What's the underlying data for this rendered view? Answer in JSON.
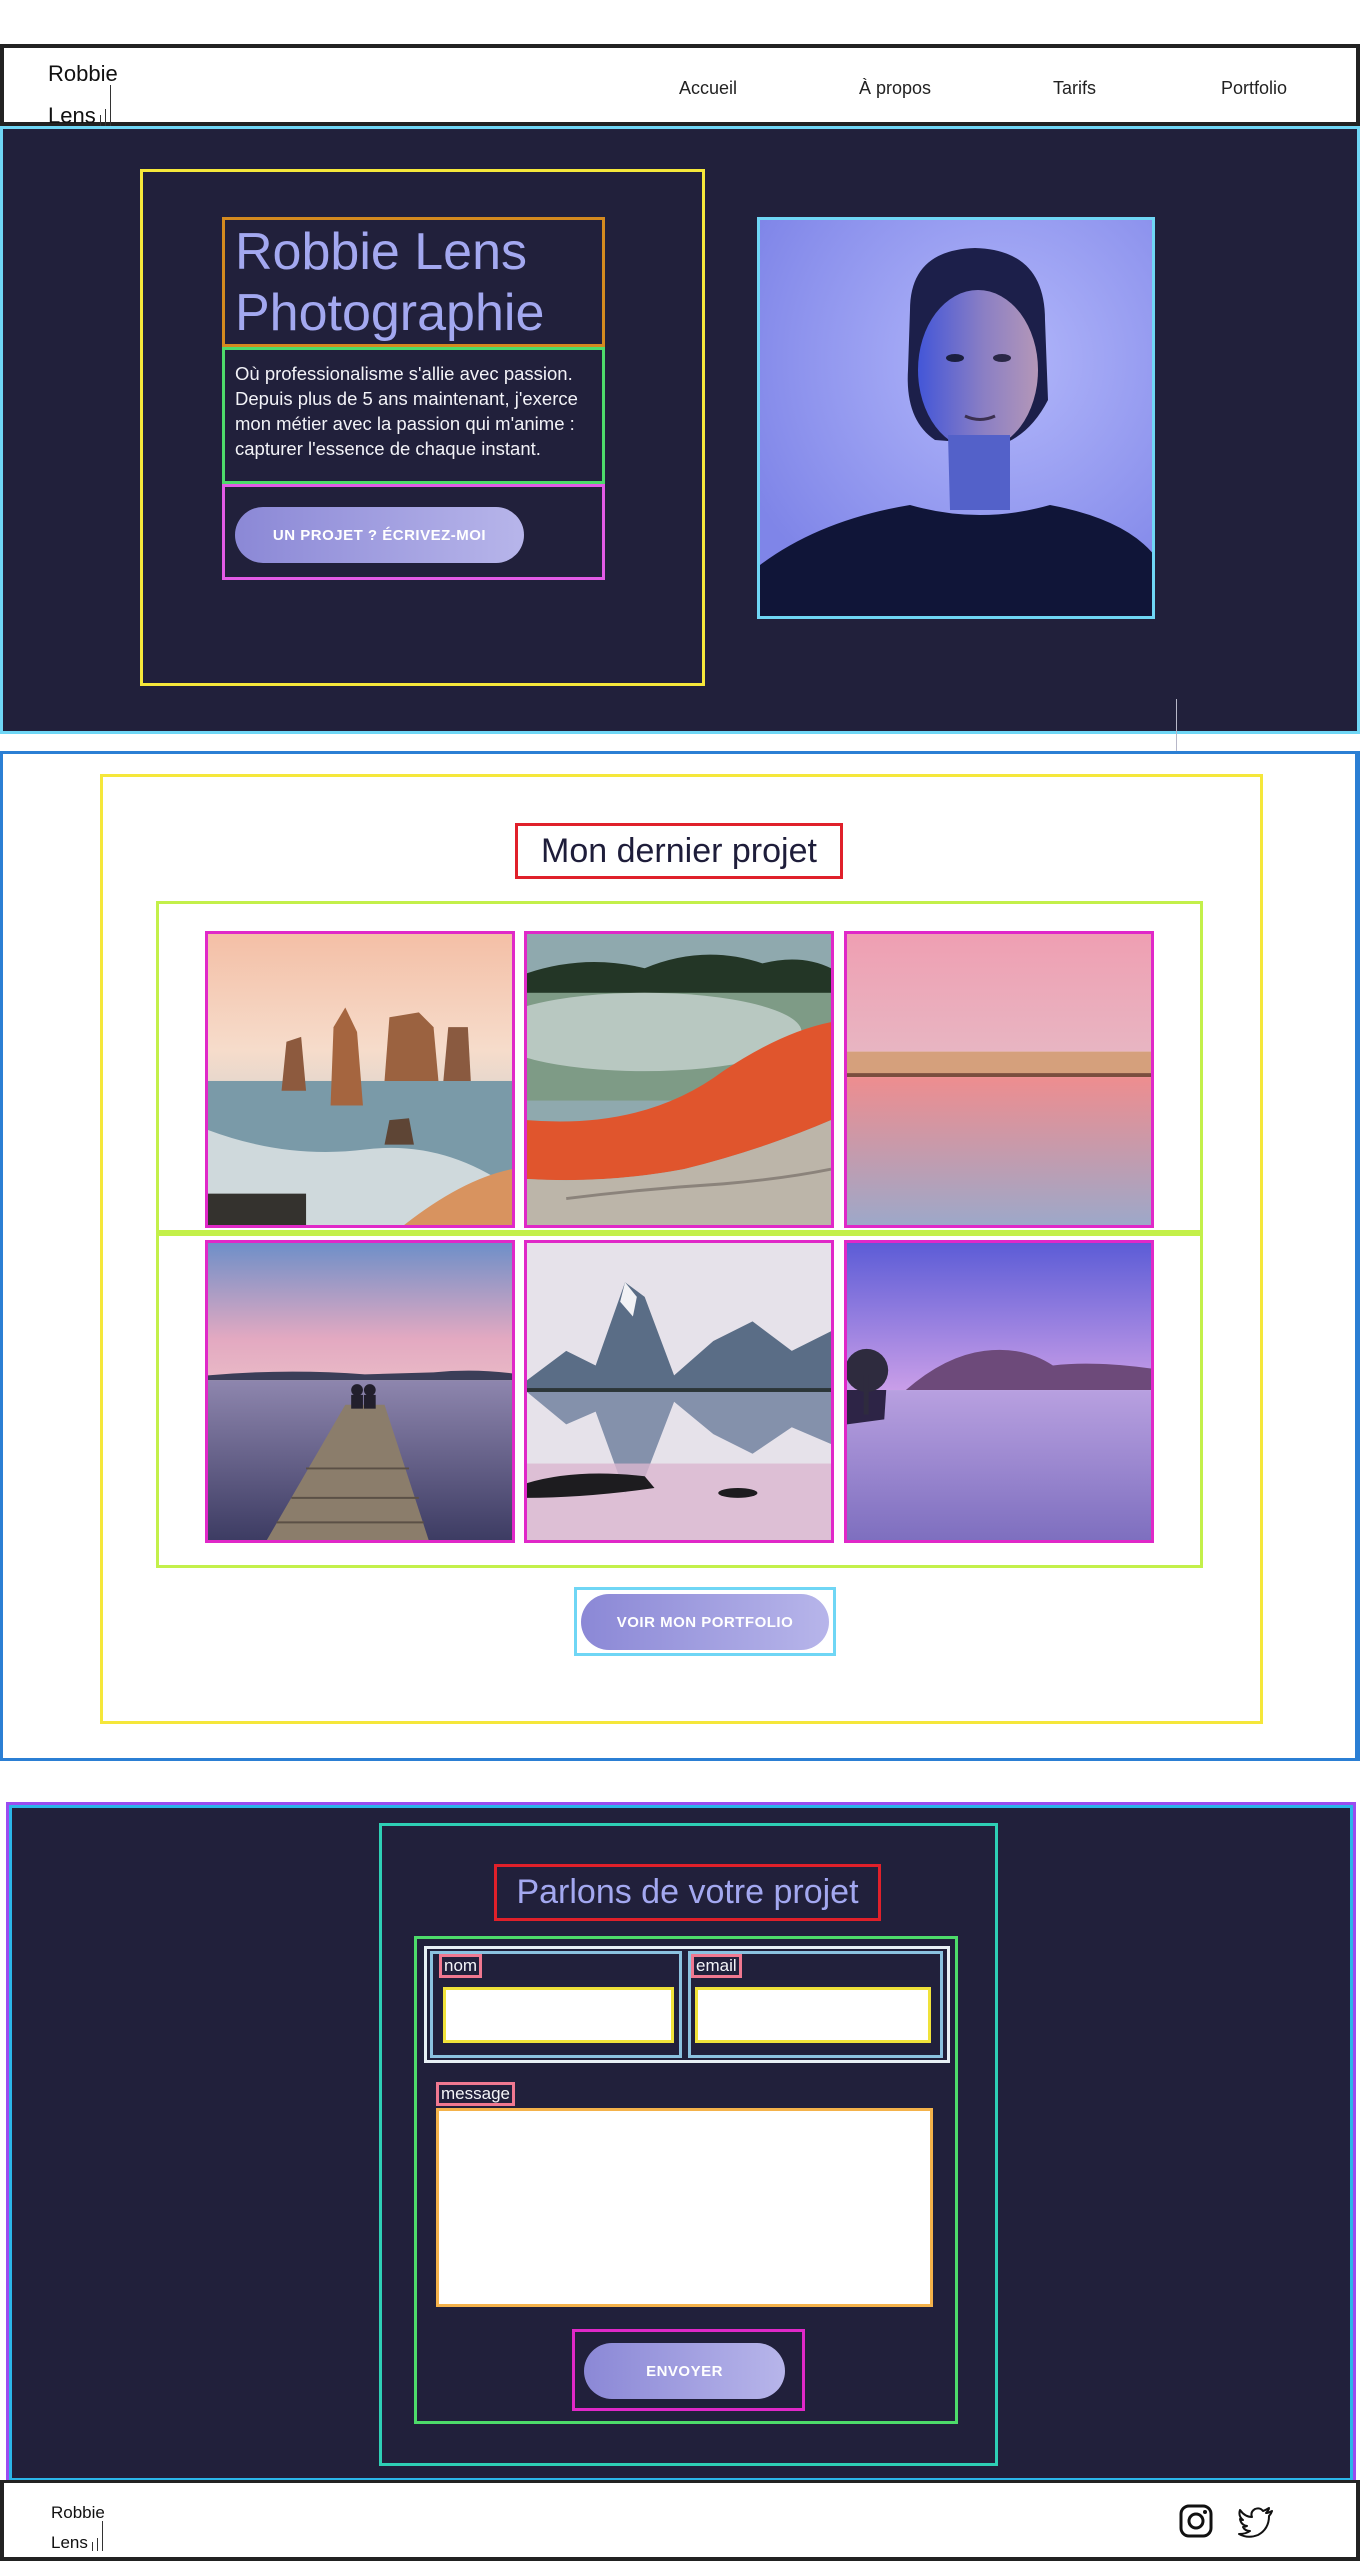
{
  "brand": {
    "line1": "Robbie",
    "line2": "Lens"
  },
  "nav": [
    {
      "label": "Accueil"
    },
    {
      "label": "À propos"
    },
    {
      "label": "Tarifs"
    },
    {
      "label": "Portfolio"
    }
  ],
  "hero": {
    "title_line1": "Robbie Lens",
    "title_line2": "Photographie",
    "description": "Où professionalisme s'allie avec passion. Depuis plus de 5 ans maintenant, j'exerce mon métier avec la passion qui m'anime : capturer l'essence de chaque instant.",
    "cta_label": "UN PROJET ? ÉCRIVEZ-MOI",
    "portrait_alt": "portrait"
  },
  "project": {
    "title": "Mon dernier projet",
    "photos": [
      {
        "subject": "sea-stacks-coast"
      },
      {
        "subject": "geothermal-pool"
      },
      {
        "subject": "pink-sunset-beach"
      },
      {
        "subject": "couple-on-pier"
      },
      {
        "subject": "mountain-lake-reflection"
      },
      {
        "subject": "lone-tree-lake-purple"
      }
    ],
    "cta_label": "VOIR MON PORTFOLIO"
  },
  "contact": {
    "title": "Parlons de votre projet",
    "name_label": "nom",
    "name_value": "",
    "email_label": "email",
    "email_value": "",
    "message_label": "message",
    "message_value": "",
    "submit_label": "ENVOYER"
  },
  "footer": {
    "social": [
      {
        "icon": "instagram-icon"
      },
      {
        "icon": "twitter-icon"
      }
    ]
  },
  "colors": {
    "dark_bg": "#21203b",
    "accent": "#a3a8f0",
    "button_start": "#8b88d6",
    "button_end": "#b7b5ea"
  }
}
